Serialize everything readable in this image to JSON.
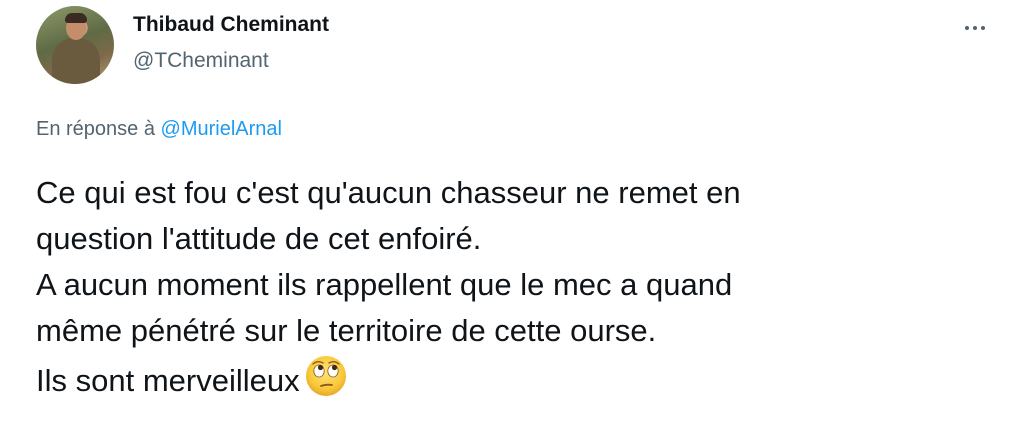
{
  "tweet": {
    "author_name": "Thibaud Cheminant",
    "author_handle": "@TCheminant",
    "more_icon": "more-horizontal-icon",
    "reply_prefix": "En réponse à",
    "reply_mention": "@MurielArnal",
    "text_lines": [
      "Ce qui est fou c'est qu'aucun chasseur ne remet en",
      "question l'attitude de cet enfoiré.",
      "A aucun moment ils rappellent que le mec a quand",
      "même pénétré sur le territoire de cette ourse.",
      "Ils sont merveilleux"
    ],
    "emoji": "face-with-rolling-eyes-emoji",
    "colors": {
      "text": "#0f1419",
      "secondary": "#536471",
      "link": "#1d9bf0"
    }
  }
}
